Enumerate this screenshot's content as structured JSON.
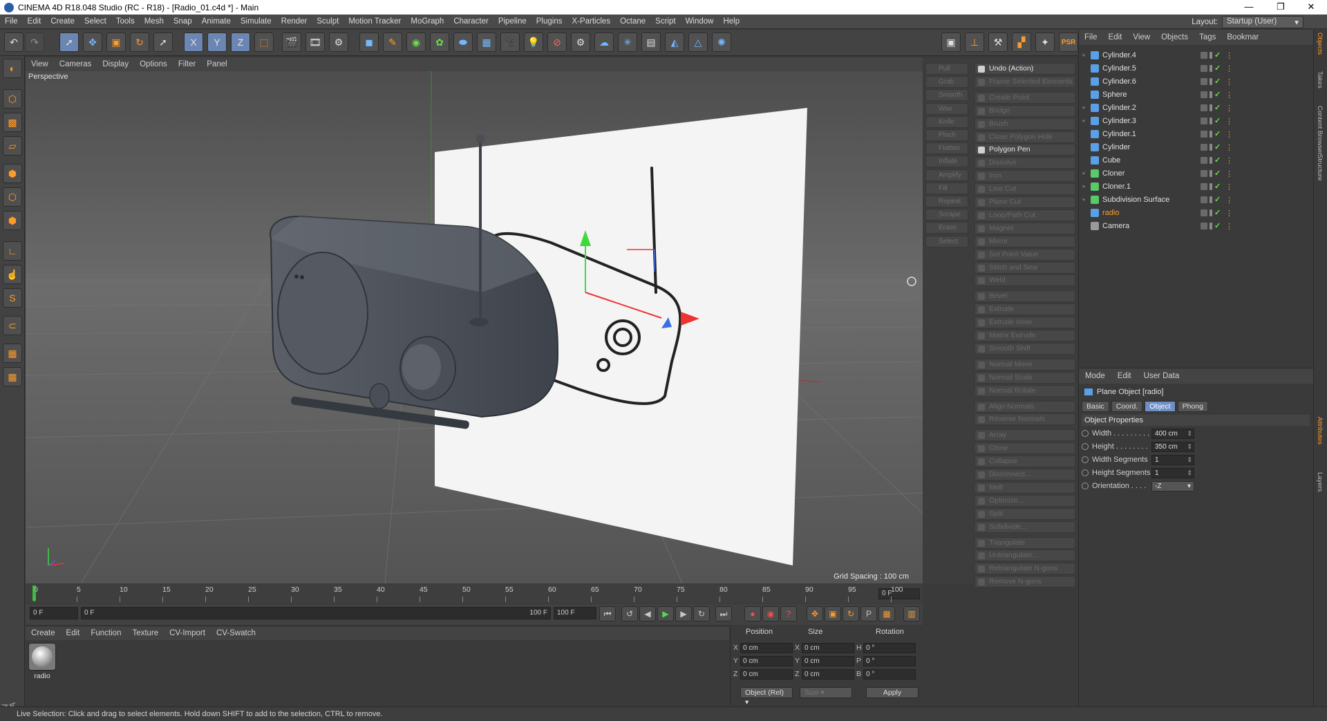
{
  "window": {
    "title": "CINEMA 4D R18.048 Studio (RC - R18) - [Radio_01.c4d *] - Main",
    "minimize": "—",
    "maximize": "❐",
    "close": "✕"
  },
  "menubar": [
    "File",
    "Edit",
    "Create",
    "Select",
    "Tools",
    "Mesh",
    "Snap",
    "Animate",
    "Simulate",
    "Render",
    "Sculpt",
    "Motion Tracker",
    "MoGraph",
    "Character",
    "Pipeline",
    "Plugins",
    "X-Particles",
    "Octane",
    "Script",
    "Window",
    "Help"
  ],
  "layout": {
    "label": "Layout:",
    "value": "Startup (User)"
  },
  "viewport": {
    "menu": [
      "View",
      "Cameras",
      "Display",
      "Options",
      "Filter",
      "Panel"
    ],
    "label": "Perspective",
    "grid_spacing": "Grid Spacing : 100 cm"
  },
  "timeline": {
    "ticks": [
      "0",
      "5",
      "10",
      "15",
      "20",
      "25",
      "30",
      "35",
      "40",
      "45",
      "50",
      "55",
      "60",
      "65",
      "70",
      "75",
      "80",
      "85",
      "90",
      "95",
      "100"
    ],
    "current_frame": "0 F"
  },
  "transport": {
    "start": "0 F",
    "range_start": "0 F",
    "range_end": "100 F",
    "end": "100 F"
  },
  "material": {
    "menu": [
      "Create",
      "Edit",
      "Function",
      "Texture",
      "CV-Import",
      "CV-Swatch"
    ],
    "items": [
      {
        "name": "radio"
      }
    ]
  },
  "coords": {
    "headers": {
      "position": "Position",
      "size": "Size",
      "rotation": "Rotation"
    },
    "rows": [
      {
        "axis": "X",
        "pos": "0 cm",
        "saxis": "X",
        "size": "0 cm",
        "raxis": "H",
        "rot": "0 °"
      },
      {
        "axis": "Y",
        "pos": "0 cm",
        "saxis": "Y",
        "size": "0 cm",
        "raxis": "P",
        "rot": "0 °"
      },
      {
        "axis": "Z",
        "pos": "0 cm",
        "saxis": "Z",
        "size": "0 cm",
        "raxis": "B",
        "rot": "0 °"
      }
    ],
    "mode": "Object (Rel)",
    "size_mode": "Size",
    "apply": "Apply"
  },
  "status": "Live Selection: Click and drag to select elements. Hold down SHIFT to add to the selection, CTRL to remove.",
  "commands_left": [
    "Pull",
    "Grab",
    "Smooth",
    "Wax",
    "Knife",
    "Pinch",
    "Flatten",
    "Inflate",
    "Amplify",
    "Fill",
    "Repeat",
    "Scrape",
    "Erase",
    "Select"
  ],
  "commands_right": [
    {
      "label": "Undo (Action)",
      "on": true
    },
    {
      "label": "Frame Selected Elements",
      "on": false
    },
    {
      "label": "Create Point",
      "on": false
    },
    {
      "label": "Bridge",
      "on": false
    },
    {
      "label": "Brush",
      "on": false
    },
    {
      "label": "Close Polygon Hole",
      "on": false
    },
    {
      "label": "Polygon Pen",
      "on": true
    },
    {
      "label": "Dissolve",
      "on": false
    },
    {
      "label": "Iron",
      "on": false
    },
    {
      "label": "Line Cut",
      "on": false
    },
    {
      "label": "Plane Cut",
      "on": false
    },
    {
      "label": "Loop/Path Cut",
      "on": false
    },
    {
      "label": "Magnet",
      "on": false
    },
    {
      "label": "Mirror",
      "on": false
    },
    {
      "label": "Set Point Value",
      "on": false
    },
    {
      "label": "Stitch and Sew",
      "on": false
    },
    {
      "label": "Weld",
      "on": false
    },
    {
      "label": "Bevel",
      "on": false
    },
    {
      "label": "Extrude",
      "on": false
    },
    {
      "label": "Extrude Inner",
      "on": false
    },
    {
      "label": "Matrix Extrude",
      "on": false
    },
    {
      "label": "Smooth Shift",
      "on": false
    },
    {
      "label": "Normal Move",
      "on": false
    },
    {
      "label": "Normal Scale",
      "on": false
    },
    {
      "label": "Normal Rotate",
      "on": false
    },
    {
      "label": "Align Normals",
      "on": false
    },
    {
      "label": "Reverse Normals",
      "on": false
    },
    {
      "label": "Array",
      "on": false
    },
    {
      "label": "Clone",
      "on": false
    },
    {
      "label": "Collapse",
      "on": false
    },
    {
      "label": "Disconnect...",
      "on": false
    },
    {
      "label": "Melt",
      "on": false
    },
    {
      "label": "Optimize...",
      "on": false
    },
    {
      "label": "Split",
      "on": false
    },
    {
      "label": "Subdivide...",
      "on": false
    },
    {
      "label": "Triangulate",
      "on": false
    },
    {
      "label": "Untriangulate...",
      "on": false
    },
    {
      "label": "Retriangulate N-gons",
      "on": false
    },
    {
      "label": "Remove N-gons",
      "on": false
    }
  ],
  "objects": {
    "menu": [
      "File",
      "Edit",
      "View",
      "Objects",
      "Tags",
      "Bookmar"
    ],
    "items": [
      {
        "name": "Cylinder.4",
        "expand": "+",
        "color": "#5aa0e6",
        "highlight": false
      },
      {
        "name": "Cylinder.5",
        "expand": "",
        "color": "#5aa0e6",
        "highlight": false
      },
      {
        "name": "Cylinder.6",
        "expand": "",
        "color": "#5aa0e6",
        "highlight": false
      },
      {
        "name": "Sphere",
        "expand": "",
        "color": "#5aa0e6",
        "highlight": false
      },
      {
        "name": "Cylinder.2",
        "expand": "+",
        "color": "#5aa0e6",
        "highlight": false
      },
      {
        "name": "Cylinder.3",
        "expand": "+",
        "color": "#5aa0e6",
        "highlight": false
      },
      {
        "name": "Cylinder.1",
        "expand": "",
        "color": "#5aa0e6",
        "highlight": false
      },
      {
        "name": "Cylinder",
        "expand": "",
        "color": "#5aa0e6",
        "highlight": false
      },
      {
        "name": "Cube",
        "expand": "",
        "color": "#5aa0e6",
        "highlight": false
      },
      {
        "name": "Cloner",
        "expand": "+",
        "color": "#59c96a",
        "highlight": false
      },
      {
        "name": "Cloner.1",
        "expand": "+",
        "color": "#59c96a",
        "highlight": false
      },
      {
        "name": "Subdivision Surface",
        "expand": "+",
        "color": "#59c96a",
        "highlight": false
      },
      {
        "name": "radio",
        "expand": "",
        "color": "#5aa0e6",
        "highlight": true
      },
      {
        "name": "Camera",
        "expand": "",
        "color": "#9a9a9a",
        "highlight": false
      }
    ]
  },
  "attributes": {
    "menu": [
      "Mode",
      "Edit",
      "User Data"
    ],
    "title": "Plane Object [radio]",
    "tabs": [
      {
        "label": "Basic",
        "sel": false
      },
      {
        "label": "Coord.",
        "sel": false
      },
      {
        "label": "Object",
        "sel": true
      },
      {
        "label": "Phong",
        "sel": false
      }
    ],
    "section": "Object Properties",
    "props": [
      {
        "label": "Width . . . . . . . . .",
        "value": "400 cm"
      },
      {
        "label": "Height . . . . . . . .",
        "value": "350 cm"
      },
      {
        "label": "Width Segments",
        "value": "1"
      },
      {
        "label": "Height Segments",
        "value": "1"
      },
      {
        "label": "Orientation . . . . ",
        "value": "-Z"
      }
    ]
  },
  "side_tabs": [
    "Objects",
    "Takes",
    "Content Browser",
    "Structure",
    "Attributes",
    "Layers"
  ],
  "colors": {
    "accent": "#ff9b28",
    "selected_tab": "#6f8fc5",
    "viewport_bg": "#5d5d5d"
  }
}
